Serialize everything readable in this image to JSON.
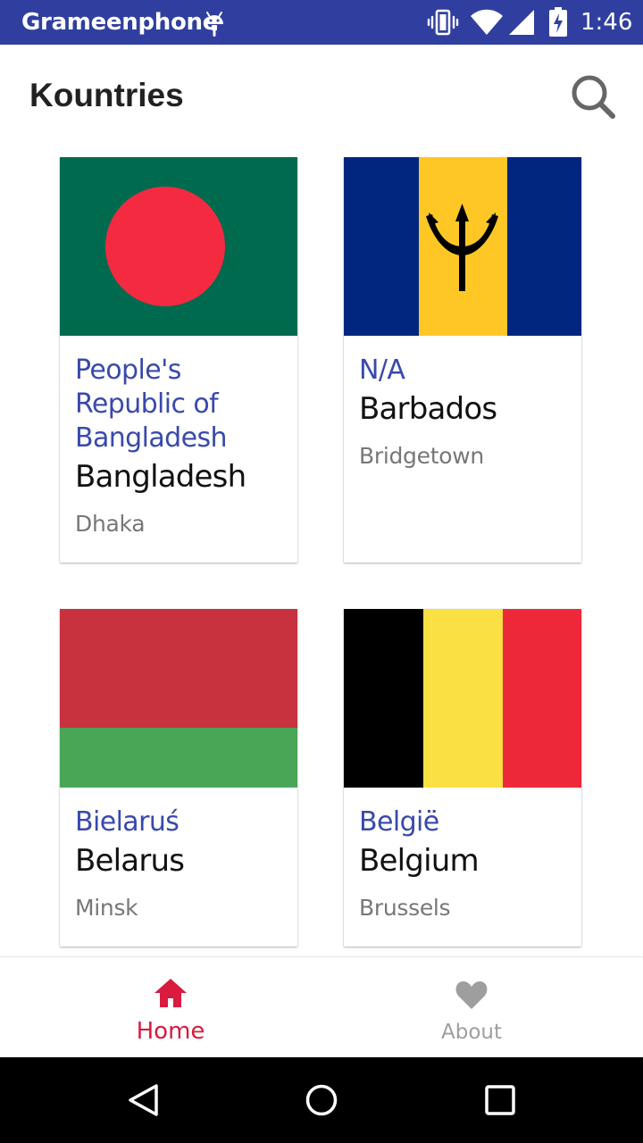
{
  "status_bar": {
    "carrier": "Grameenphone",
    "time": "1:46",
    "icons": [
      "android-icon",
      "vibrate-icon",
      "wifi-icon",
      "cell-signal-icon",
      "battery-charging-icon"
    ]
  },
  "app_bar": {
    "title": "Kountries",
    "search_icon": "search-icon"
  },
  "countries": [
    {
      "native_name": "People's Republic of Bangladesh",
      "name": "Bangladesh",
      "capital": "Dhaka",
      "flag": {
        "base": "#006a4e",
        "disc": "#f42a41"
      }
    },
    {
      "native_name": "N/A",
      "name": "Barbados",
      "capital": "Bridgetown",
      "flag": {
        "blue": "#00267f",
        "gold": "#ffc726",
        "trident": "#000000"
      }
    },
    {
      "native_name": "Bielaruś",
      "name": "Belarus",
      "capital": "Minsk",
      "flag": {
        "red": "#c8313e",
        "green": "#4aa657"
      }
    },
    {
      "native_name": "België",
      "name": "Belgium",
      "capital": "Brussels",
      "flag": {
        "black": "#000000",
        "yellow": "#fae042",
        "red": "#ed2939"
      }
    }
  ],
  "bottom_nav": {
    "items": [
      {
        "label": "Home",
        "icon": "home-icon",
        "active": true
      },
      {
        "label": "About",
        "icon": "heart-icon",
        "active": false
      }
    ],
    "active_color": "#d81b3e",
    "inactive_color": "#9e9e9e"
  },
  "system_nav": {
    "icons": [
      "back-icon",
      "home-circle-icon",
      "recents-icon"
    ]
  },
  "colors": {
    "status_bar": "#303f9f",
    "accent_text": "#3949ab"
  }
}
